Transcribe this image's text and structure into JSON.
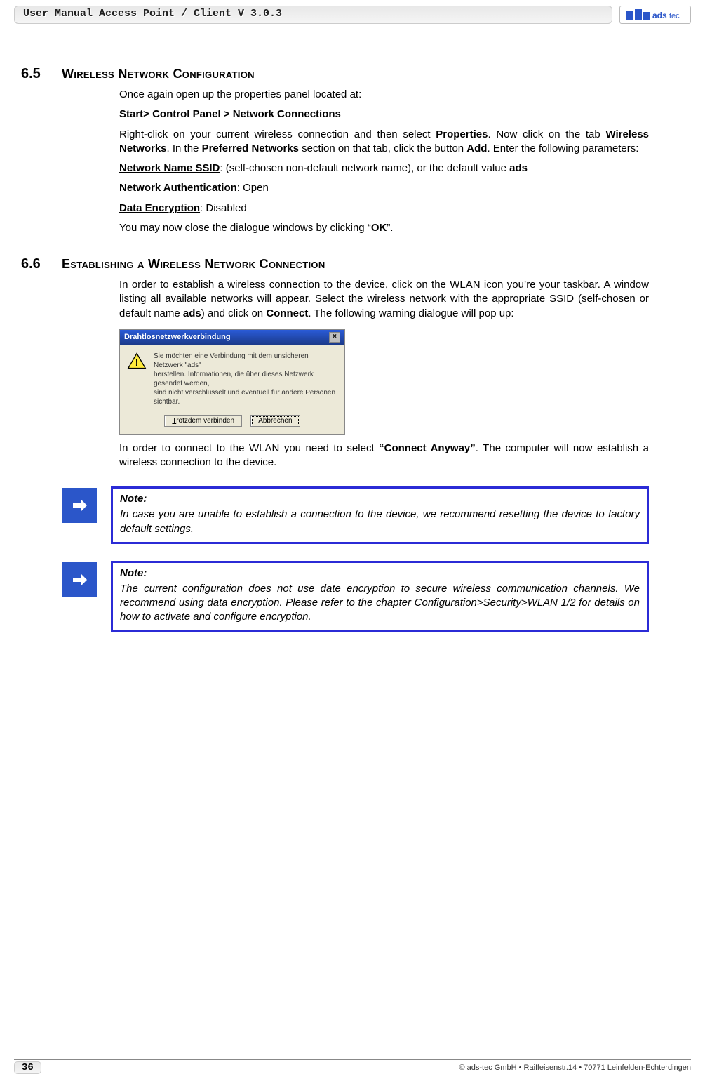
{
  "header": {
    "title": "User Manual Access Point / Client V 3.0.3",
    "logo_text": "ads tec"
  },
  "sections": [
    {
      "num": "6.5",
      "title": "Wireless Network Configuration",
      "p1": "Once again open up the properties panel located at:",
      "p2": "Start> Control Panel > Network Connections",
      "p3a": "Right-click on your current wireless connection and then select ",
      "p3b": "Properties",
      "p3c": ". Now click on the tab ",
      "p3d": "Wireless Networks",
      "p3e": ". In the ",
      "p3f": "Preferred Networks",
      "p3g": " section on that tab, click the button ",
      "p3h": "Add",
      "p3i": ". Enter the following parameters:",
      "p4a": "Network Name SSID",
      "p4b": ": (self-chosen non-default network name), or the default value ",
      "p4c": "ads",
      "p5a": "Network Authentication",
      "p5b": ": Open",
      "p6a": "Data Encryption",
      "p6b": ": Disabled",
      "p7a": "You may now close the dialogue windows by clicking “",
      "p7b": "OK",
      "p7c": "”."
    },
    {
      "num": "6.6",
      "title": "Establishing a Wireless Network Connection",
      "p1a": "In order to establish a wireless connection to the device, click on the WLAN icon you’re your taskbar. A window listing all available networks will appear. Select the wireless network with the appropriate SSID (self-chosen or default name ",
      "p1b": "ads",
      "p1c": ") and click on ",
      "p1d": "Connect",
      "p1e": ". The following warning dialogue will pop up:",
      "p2a": "In order to connect to the WLAN you need to select ",
      "p2b": "“Connect Anyway”",
      "p2c": ". The computer will now establish a wireless connection to the device."
    }
  ],
  "dialog": {
    "title": "Drahtlosnetzwerkverbindung",
    "line1": "Sie möchten eine Verbindung mit dem unsicheren Netzwerk \"ads\"",
    "line2": "herstellen. Informationen, die über dieses Netzwerk gesendet werden,",
    "line3": "sind nicht verschlüsselt und eventuell für andere Personen sichtbar.",
    "btn1": "Trotzdem verbinden",
    "btn2": "Abbrechen"
  },
  "notes": [
    {
      "title": "Note:",
      "text": "In case you are unable to establish a connection to the device, we recommend resetting the device to factory default settings."
    },
    {
      "title": "Note:",
      "text": "The current configuration does not use date encryption to secure wireless communication channels. We recommend using data encryption. Please refer to the chapter Configuration>Security>WLAN 1/2 for details on how to activate and configure encryption."
    }
  ],
  "footer": {
    "page": "36",
    "copyright": "© ads-tec GmbH • Raiffeisenstr.14 • 70771 Leinfelden-Echterdingen"
  }
}
